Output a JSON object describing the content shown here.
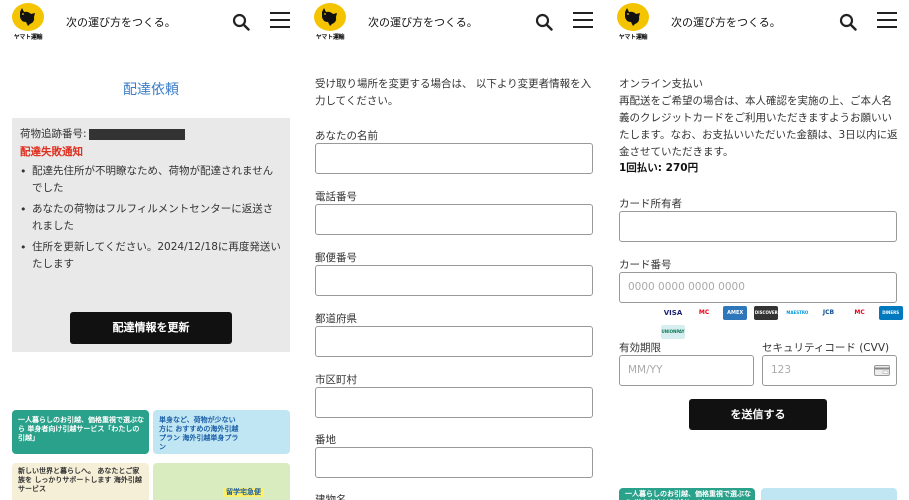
{
  "header": {
    "brand": "ヤマト運輸",
    "tagline": "次の運び方をつくる。"
  },
  "panel1": {
    "title": "配達依頼",
    "tracking_label": "荷物追跡番号:",
    "fail_label": "配達失敗通知",
    "notices": [
      "配達先住所が不明瞭なため、荷物が配達されませんでした",
      "あなたの荷物はフルフィルメントセンターに返送されました",
      "住所を更新してください。2024/12/18に再度発送いたします"
    ],
    "update_button": "配達情報を更新",
    "banners": [
      {
        "text": "一人暮らしのお引越、価格重視で選ぶなら 単身者向け引越サービス「わたしの引越」"
      },
      {
        "text": "単身など、荷物が少ない方に おすすめの海外引越プラン 海外引越単身プラン"
      },
      {
        "text": "新しい世界と暮らしへ。 あなたとご家族を しっかりサポートします 海外引越サービス"
      },
      {
        "text": "留学宅急便"
      }
    ]
  },
  "panel2": {
    "intro": "受け取り場所を変更する場合は、 以下より変更者情報を入力してください。",
    "fields": [
      {
        "label": "あなたの名前",
        "value": ""
      },
      {
        "label": "電話番号",
        "value": ""
      },
      {
        "label": "郵便番号",
        "value": ""
      },
      {
        "label": "都道府県",
        "value": ""
      },
      {
        "label": "市区町村",
        "value": ""
      },
      {
        "label": "番地",
        "value": ""
      },
      {
        "label": "建物名",
        "value": ""
      }
    ]
  },
  "panel3": {
    "heading": "オンライン支払い",
    "body": "再配送をご希望の場合は、本人確認を実施の上、ご本人名義のクレジットカードをご利用いただきますようお願いいたします。なお、お支払いいただいた金額は、3日以内に返金させていただきます。",
    "fee": "1回払い: 270円",
    "cardholder_label": "カード所有者",
    "card_number_label": "カード番号",
    "card_number_placeholder": "0000 0000 0000 0000",
    "card_brands": [
      "VISA",
      "MC",
      "AMEX",
      "DISCOVER",
      "MAESTRO",
      "JCB",
      "MC",
      "DINERS",
      "UNIONPAY"
    ],
    "expiry_label": "有効期限",
    "expiry_placeholder": "MM/YY",
    "cvv_label": "セキュリティコード (CVV)",
    "cvv_placeholder": "123",
    "submit_button": "を送信する",
    "banner_text": "一人暮らしのお引越、価格重視で選ぶなら 単身者向け引越サービス"
  }
}
